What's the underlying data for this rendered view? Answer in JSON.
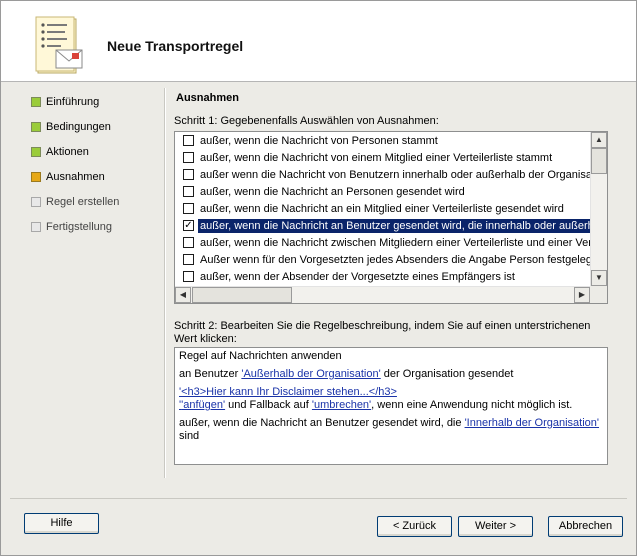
{
  "header": {
    "title": "Neue Transportregel",
    "icon": "wizard-document-icon"
  },
  "steps": [
    {
      "label": "Einführung",
      "state": "done"
    },
    {
      "label": "Bedingungen",
      "state": "done"
    },
    {
      "label": "Aktionen",
      "state": "done"
    },
    {
      "label": "Ausnahmen",
      "state": "current"
    },
    {
      "label": "Regel erstellen",
      "state": "pending"
    },
    {
      "label": "Fertigstellung",
      "state": "pending"
    }
  ],
  "section": {
    "title": "Ausnahmen",
    "step1_label": "Schritt 1: Gegebenenfalls Auswählen von Ausnahmen:",
    "exceptions": [
      {
        "text": "außer, wenn die Nachricht von Personen stammt",
        "checked": false
      },
      {
        "text": "außer, wenn die Nachricht von einem Mitglied einer Verteilerliste stammt",
        "checked": false
      },
      {
        "text": "außer wenn die Nachricht von Benutzern innerhalb oder außerhalb der Organisation",
        "checked": false
      },
      {
        "text": "außer, wenn die Nachricht an Personen gesendet wird",
        "checked": false
      },
      {
        "text": "außer, wenn die Nachricht an ein Mitglied einer Verteilerliste gesendet wird",
        "checked": false
      },
      {
        "text": "außer, wenn die Nachricht an Benutzer gesendet wird, die innerhalb oder außerhalb",
        "checked": true,
        "selected": true
      },
      {
        "text": "außer, wenn die Nachricht zwischen Mitgliedern einer Verteilerliste und einer Verteil",
        "checked": false
      },
      {
        "text": "Außer wenn für den Vorgesetzten jedes Absenders die Angabe Person festgelegt w",
        "checked": false
      },
      {
        "text": "außer, wenn der Absender der Vorgesetzte eines Empfängers ist",
        "checked": false
      }
    ],
    "step2_label": "Schritt 2: Bearbeiten Sie die Regelbeschreibung, indem Sie auf einen unterstrichenen Wert klicken:",
    "description": {
      "line1": "Regel auf Nachrichten anwenden",
      "line2_pre": "an Benutzer ",
      "line2_link": "'Außerhalb der Organisation'",
      "line2_post": " der Organisation gesendet",
      "line3_link1": "'<h3>Hier kann Ihr Disclaimer stehen...</h3>",
      "line3_link1b": "'",
      "line3_link2": "'anfügen'",
      "line3_mid": " und Fallback auf ",
      "line3_link3": "'umbrechen'",
      "line3_post": ", wenn eine Anwendung nicht möglich ist.",
      "line4_pre": "außer, wenn die Nachricht an Benutzer gesendet wird, die ",
      "line4_link": "'Innerhalb der Organisation'",
      "line4_post": " sind"
    }
  },
  "buttons": {
    "help": "Hilfe",
    "back": "< Zurück",
    "next": "Weiter >",
    "cancel": "Abbrechen"
  }
}
